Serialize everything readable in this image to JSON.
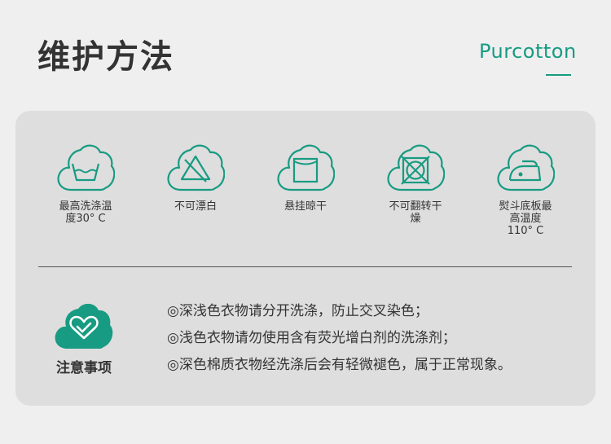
{
  "header": {
    "title": "维护方法",
    "brand": "Purcotton"
  },
  "colors": {
    "accent": "#179b82",
    "panel": "#dedede",
    "background": "#efefef",
    "text": "#333333"
  },
  "care_instructions": [
    {
      "icon": "wash-30-icon",
      "line1": "最高洗涤温",
      "line2": "度30° C",
      "line3": ""
    },
    {
      "icon": "no-bleach-icon",
      "line1": "不可漂白",
      "line2": "",
      "line3": ""
    },
    {
      "icon": "hang-dry-icon",
      "line1": "悬挂晾干",
      "line2": "",
      "line3": ""
    },
    {
      "icon": "no-tumble-dry-icon",
      "line1": "不可翻转干",
      "line2": "燥",
      "line3": ""
    },
    {
      "icon": "iron-low-icon",
      "line1": "熨斗底板最",
      "line2": "高温度",
      "line3": "110° C"
    }
  ],
  "notice": {
    "icon": "heart-cloud-icon",
    "title": "注意事项",
    "items": [
      "◎深浅色衣物请分开洗涤，防止交叉染色；",
      "◎浅色衣物请勿使用含有荧光增白剂的洗涤剂；",
      "◎深色棉质衣物经洗涤后会有轻微褪色，属于正常现象。"
    ]
  }
}
